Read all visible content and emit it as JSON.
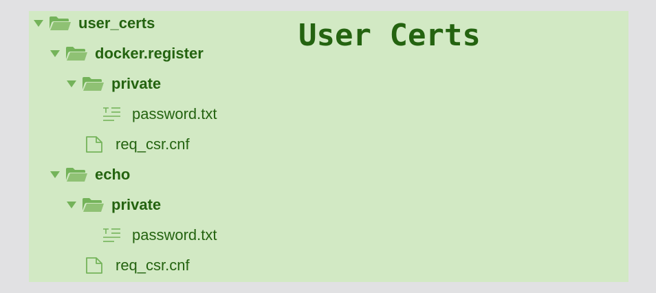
{
  "title": "User Certs",
  "tree": [
    {
      "type": "folder",
      "label": "user_certs",
      "icon": "folder-open-icon"
    },
    {
      "type": "folder",
      "label": "docker.register",
      "icon": "folder-open-icon"
    },
    {
      "type": "folder",
      "label": "private",
      "icon": "folder-open-icon"
    },
    {
      "type": "text-file",
      "label": "password.txt",
      "icon": "text-file-icon"
    },
    {
      "type": "file",
      "label": "req_csr.cnf",
      "icon": "file-icon"
    },
    {
      "type": "folder",
      "label": "echo",
      "icon": "folder-open-icon"
    },
    {
      "type": "folder",
      "label": "private",
      "icon": "folder-open-icon"
    },
    {
      "type": "text-file",
      "label": "password.txt",
      "icon": "text-file-icon"
    },
    {
      "type": "file",
      "label": "req_csr.cnf",
      "icon": "file-icon"
    }
  ],
  "colors": {
    "background": "#e1e1e3",
    "panel": "#d2e9c4",
    "text": "#246310",
    "icon": "#74b35a"
  }
}
